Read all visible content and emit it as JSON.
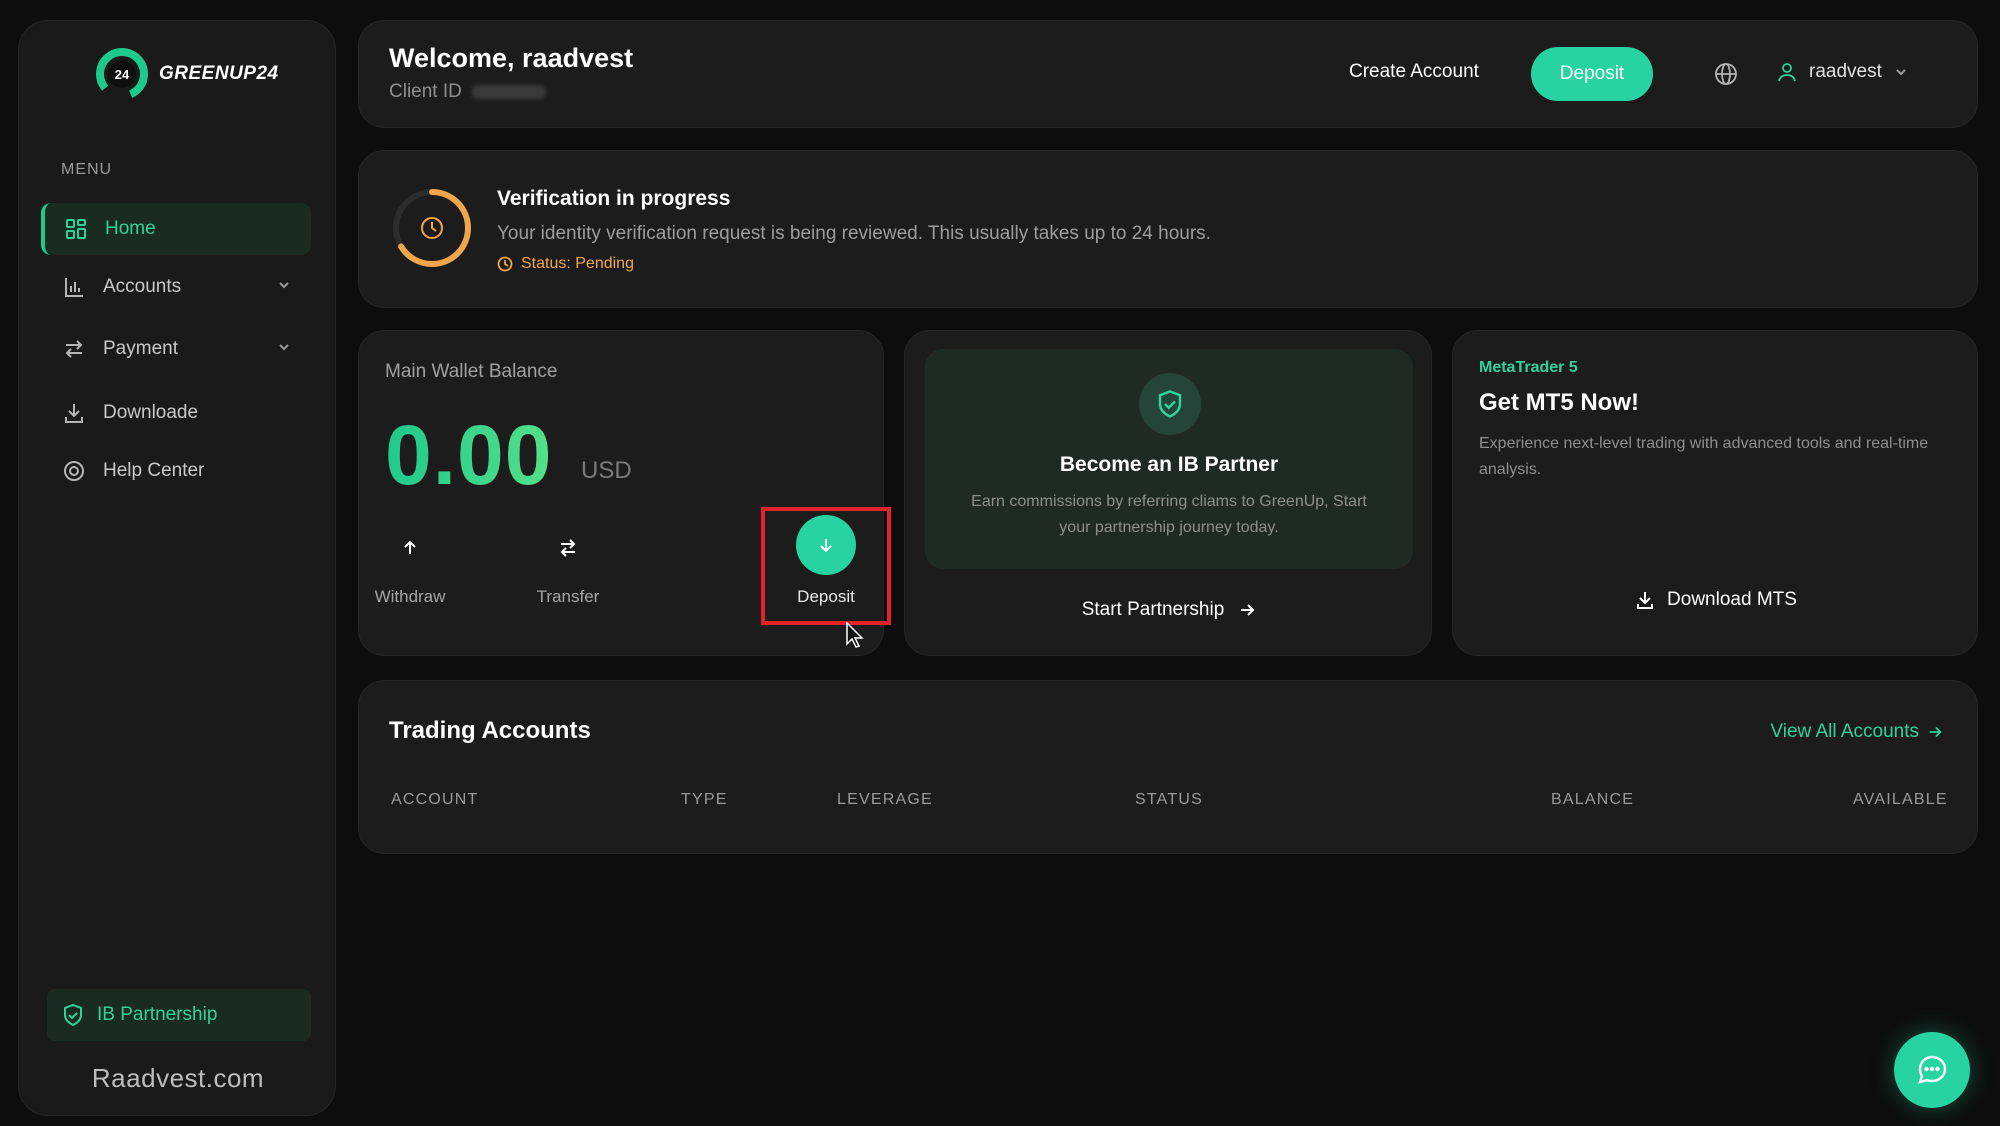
{
  "brand": {
    "name": "GREENUP24",
    "badge": "24"
  },
  "sidebar": {
    "menu_label": "MENU",
    "items": [
      {
        "label": "Home",
        "icon": "grid-icon",
        "active": true
      },
      {
        "label": "Accounts",
        "icon": "bar-chart-icon",
        "expandable": true
      },
      {
        "label": "Payment",
        "icon": "swap-icon",
        "expandable": true
      },
      {
        "label": "Downloade",
        "icon": "download-icon"
      },
      {
        "label": "Help Center",
        "icon": "help-icon"
      }
    ],
    "ib_label": "IB Partnership",
    "watermark": "Raadvest.com"
  },
  "header": {
    "welcome": "Welcome, raadvest",
    "client_id_label": "Client ID",
    "create_account": "Create Account",
    "deposit": "Deposit",
    "username": "raadvest"
  },
  "verification": {
    "title": "Verification in progress",
    "description": "Your identity verification request is being reviewed. This usually takes up to 24 hours.",
    "status": "Status: Pending"
  },
  "wallet": {
    "label": "Main Wallet Balance",
    "amount": "0.00",
    "currency": "USD",
    "actions": {
      "withdraw": "Withdraw",
      "transfer": "Transfer",
      "deposit": "Deposit"
    }
  },
  "ib_partner": {
    "title": "Become an IB Partner",
    "description": "Earn commissions by referring cliams to GreenUp, Start your partnership journey today.",
    "cta": "Start Partnership"
  },
  "mt5": {
    "tag": "MetaTrader 5",
    "title": "Get MT5 Now!",
    "description": "Experience next-level trading with advanced tools and real-time analysis.",
    "cta": "Download MTS"
  },
  "trading_accounts": {
    "title": "Trading Accounts",
    "view_all": "View All Accounts",
    "columns": [
      "ACCOUNT",
      "TYPE",
      "LEVERAGE",
      "STATUS",
      "BALANCE",
      "AVAILABLE"
    ]
  },
  "colors": {
    "accent": "#27d3a0",
    "pending": "#f0a64a",
    "highlight": "#e3232a",
    "background": "#0d0d0d",
    "panel": "#1c1c1c"
  }
}
